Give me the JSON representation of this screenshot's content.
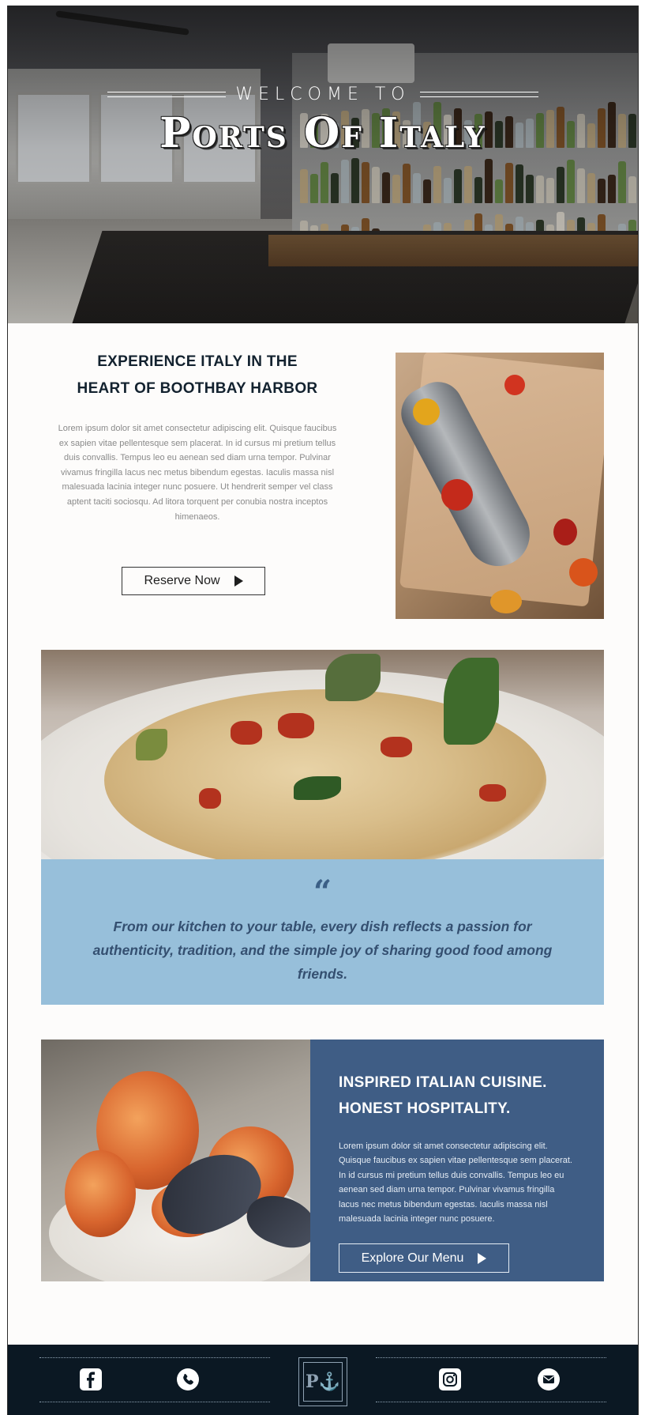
{
  "hero": {
    "welcome": "Welcome To",
    "name": "Ports Of Italy"
  },
  "experience": {
    "title_line1": "EXPERIENCE ITALY IN THE",
    "title_line2": "HEART OF BOOTHBAY HARBOR",
    "body": "Lorem ipsum dolor sit amet consectetur adipiscing elit. Quisque faucibus ex sapien vitae pellentesque sem placerat. In id cursus mi pretium tellus duis convallis. Tempus leo eu aenean sed diam urna tempor. Pulvinar vivamus fringilla lacus nec metus bibendum egestas. Iaculis massa nisl malesuada lacinia integer nunc posuere. Ut hendrerit semper vel class aptent taciti sociosqu. Ad litora torquent per conubia nostra inceptos himenaeos.",
    "button_label": "Reserve Now"
  },
  "quote": {
    "mark": "“",
    "text": "From our kitchen to your table, every dish reflects a passion for authenticity, tradition, and the simple joy of sharing good food among friends."
  },
  "cuisine": {
    "title_line1": "INSPIRED ITALIAN CUISINE.",
    "title_line2": "HONEST HOSPITALITY.",
    "body": "Lorem ipsum dolor sit amet consectetur adipiscing elit. Quisque faucibus ex sapien vitae pellentesque sem placerat. In id cursus mi pretium tellus duis convallis. Tempus leo eu aenean sed diam urna tempor. Pulvinar vivamus fringilla lacus nec metus bibendum egestas. Iaculis massa nisl malesuada lacinia integer nunc posuere.",
    "button_label": "Explore Our Menu"
  },
  "footer": {
    "icons": [
      "facebook-icon",
      "phone-icon",
      "instagram-icon",
      "email-icon"
    ],
    "logo_monogram": "P⚓"
  },
  "colors": {
    "navy_text": "#13222f",
    "quote_bg": "#97bfda",
    "quote_text": "#344f70",
    "cuisine_bg": "#3f5d85",
    "footer_bg": "#0b1823"
  }
}
